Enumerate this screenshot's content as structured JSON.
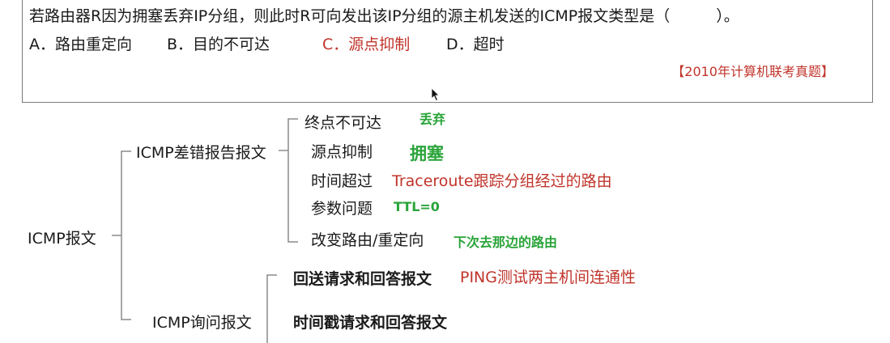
{
  "question": {
    "text": "若路由器R因为拥塞丢弃IP分组，则此时R可向发出该IP分组的源主机发送的ICMP报文类型是（　　　）。",
    "options": {
      "a": "A．路由重定向",
      "b": "B．目的不可达",
      "c": "C．源点抑制",
      "d": "D．超时"
    },
    "source": "【2010年计算机联考真题】"
  },
  "tree": {
    "root": "ICMP报文",
    "error_report": {
      "label": "ICMP差错报告报文",
      "items": [
        {
          "label": "终点不可达",
          "note": "丢弃"
        },
        {
          "label": "源点抑制",
          "note": "拥塞"
        },
        {
          "label": "时间超过",
          "note": "Traceroute跟踪分组经过的路由"
        },
        {
          "label": "参数问题",
          "note": "TTL=0"
        },
        {
          "label": "改变路由/重定向",
          "note": "下次去那边的路由"
        }
      ]
    },
    "query": {
      "label": "ICMP询问报文",
      "items": [
        {
          "label": "回送请求和回答报文",
          "note": "PING测试两主机间连通性"
        },
        {
          "label": "时间戳请求和回答报文"
        }
      ]
    }
  },
  "colors": {
    "answer_red": "#c0342b",
    "note_green": "#2aa43a",
    "line_gray": "#8a8a8a"
  }
}
